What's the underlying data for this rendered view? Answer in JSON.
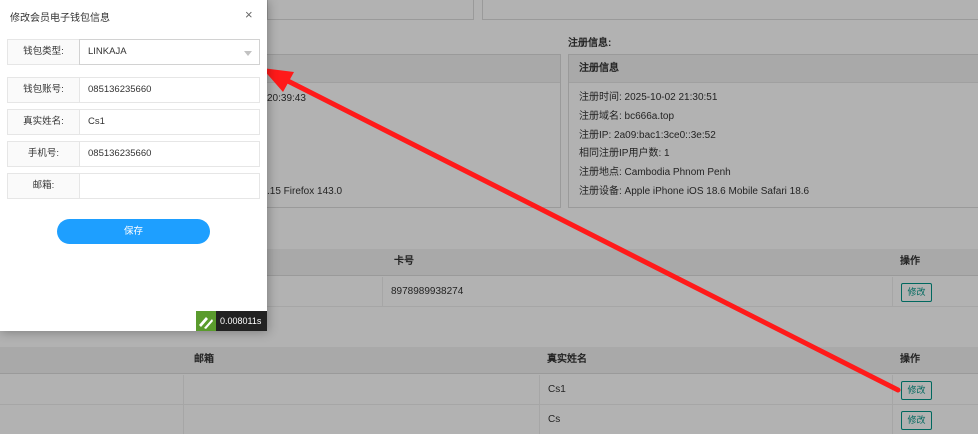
{
  "modal": {
    "title": "修改会员电子钱包信息",
    "close": "×",
    "fields": [
      {
        "label": "钱包类型:",
        "value": "LINKAJA",
        "type": "select"
      },
      {
        "label": "钱包账号:",
        "value": "085136235660",
        "type": "input"
      },
      {
        "label": "真实姓名:",
        "value": "Cs1",
        "type": "input"
      },
      {
        "label": "手机号:",
        "value": "085136235660",
        "type": "input"
      },
      {
        "label": "邮箱:",
        "value": "",
        "type": "input"
      }
    ],
    "save_label": "保存"
  },
  "timer": {
    "text": "0.008011s"
  },
  "register": {
    "section_label": "注册信息:",
    "box_title": "注册信息",
    "lines": [
      "注册时间: 2025-10-02 21:30:51",
      "注册域名: bc666a.top",
      "注册IP: 2a09:bac1:3ce0::3e:52",
      "相同注册IP用户数: 1",
      "注册地点: Cambodia Phnom Penh",
      "注册设备: Apple iPhone iOS 18.6 Mobile Safari 18.6"
    ]
  },
  "login_box": {
    "time_fragment": "20:39:43",
    "device_fragment": ".15 Firefox 143.0"
  },
  "card_table": {
    "headers": {
      "card": "卡号",
      "action": "操作"
    },
    "rows": [
      {
        "card": "8978989938274",
        "action": "修改"
      }
    ]
  },
  "wallet_table": {
    "headers": {
      "email": "邮箱",
      "name": "真实姓名",
      "action": "操作"
    },
    "rows": [
      {
        "email": "",
        "name": "Cs1",
        "action": "修改"
      },
      {
        "email": "",
        "name": "Cs",
        "action": "修改"
      }
    ]
  },
  "colors": {
    "accent": "#1e9fff",
    "edit": "#009688",
    "annotation": "#ff1a1a"
  }
}
